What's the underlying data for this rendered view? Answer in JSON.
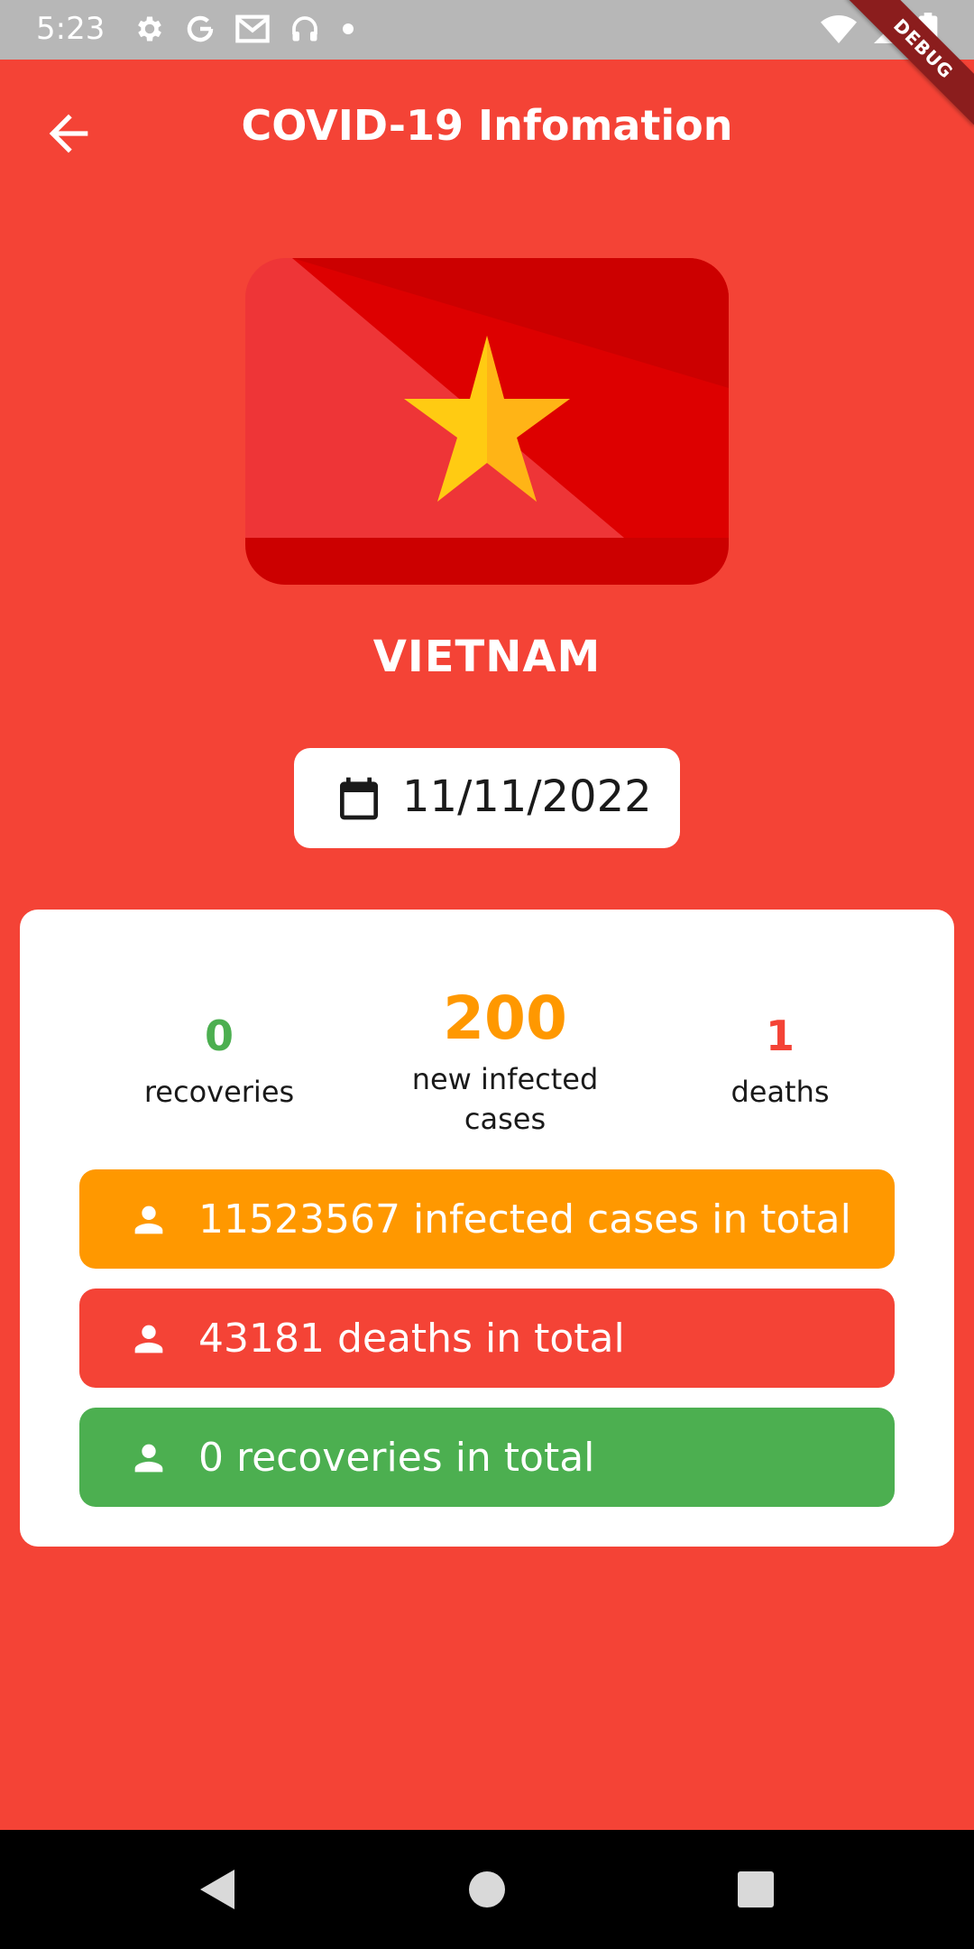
{
  "status_bar": {
    "time": "5:23",
    "icons": [
      "settings-icon",
      "google-icon",
      "gmail-icon",
      "headset-icon",
      "dot-icon",
      "wifi-icon",
      "signal-icon",
      "battery-icon"
    ]
  },
  "debug_label": "DEBUG",
  "app_bar": {
    "title": "COVID-19 Infomation",
    "back_icon": "arrow-back-icon"
  },
  "country": {
    "name": "VIETNAM",
    "flag_icon": "vietnam-flag"
  },
  "date_picker": {
    "icon": "calendar-icon",
    "value": "11/11/2022"
  },
  "daily_stats": {
    "recoveries": {
      "value": "0",
      "label": "recoveries",
      "color": "#4caf50"
    },
    "new_infected": {
      "value": "200",
      "label_line1": "new infected",
      "label_line2": "cases",
      "color": "#ff9800"
    },
    "deaths": {
      "value": "1",
      "label": "deaths",
      "color": "#f44336"
    }
  },
  "totals": {
    "infected": {
      "text": "11523567 infected cases in total",
      "color": "#ff9800",
      "icon": "person-icon"
    },
    "deaths": {
      "text": "43181 deaths in total",
      "color": "#f44336",
      "icon": "person-icon"
    },
    "recoveries": {
      "text": "0 recoveries in total",
      "color": "#4caf50",
      "icon": "person-icon"
    }
  },
  "colors": {
    "background": "#f44336",
    "card": "#ffffff"
  },
  "nav_bar": {
    "back": "nav-back-icon",
    "home": "nav-home-icon",
    "recents": "nav-recents-icon"
  }
}
